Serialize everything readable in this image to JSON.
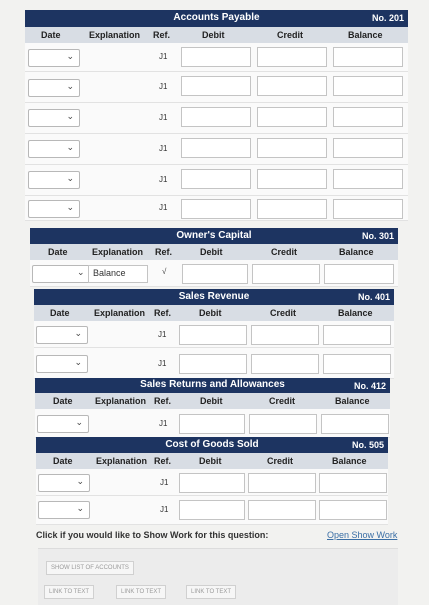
{
  "accounts_payable": {
    "title": "Accounts Payable",
    "no": "No. 201",
    "cols": {
      "date": "Date",
      "explanation": "Explanation",
      "ref": "Ref.",
      "debit": "Debit",
      "credit": "Credit",
      "balance": "Balance"
    },
    "rows": [
      {
        "ref": "J1"
      },
      {
        "ref": "J1"
      },
      {
        "ref": "J1"
      },
      {
        "ref": "J1"
      },
      {
        "ref": "J1"
      },
      {
        "ref": "J1"
      }
    ]
  },
  "owners_capital": {
    "title": "Owner's Capital",
    "no": "No. 301",
    "cols": {
      "date": "Date",
      "explanation": "Explanation",
      "ref": "Ref.",
      "debit": "Debit",
      "credit": "Credit",
      "balance": "Balance"
    },
    "rows": [
      {
        "explanation": "Balance",
        "ref": "√"
      }
    ]
  },
  "sales_revenue": {
    "title": "Sales Revenue",
    "no": "No. 401",
    "cols": {
      "date": "Date",
      "explanation": "Explanation",
      "ref": "Ref.",
      "debit": "Debit",
      "credit": "Credit",
      "balance": "Balance"
    },
    "rows": [
      {
        "ref": "J1"
      },
      {
        "ref": "J1"
      }
    ]
  },
  "sales_returns": {
    "title": "Sales Returns and Allowances",
    "no": "No. 412",
    "cols": {
      "date": "Date",
      "explanation": "Explanation",
      "ref": "Ref.",
      "debit": "Debit",
      "credit": "Credit",
      "balance": "Balance"
    },
    "rows": [
      {
        "ref": "J1"
      }
    ]
  },
  "cost_of_goods": {
    "title": "Cost of Goods Sold",
    "no": "No. 505",
    "cols": {
      "date": "Date",
      "explanation": "Explanation",
      "ref": "Ref.",
      "debit": "Debit",
      "credit": "Credit",
      "balance": "Balance"
    },
    "rows": [
      {
        "ref": "J1"
      },
      {
        "ref": "J1"
      }
    ]
  },
  "footer": {
    "prompt": "Click if you would like to Show Work for this question:",
    "link": "Open Show Work"
  },
  "buttons": {
    "show_list": "SHOW LIST OF ACCOUNTS",
    "link1": "LINK TO TEXT",
    "link2": "LINK TO TEXT",
    "link3": "LINK TO TEXT"
  },
  "colors": {
    "header": "#1d3461",
    "subheader": "#d8dde4",
    "link": "#3a6ea5"
  }
}
